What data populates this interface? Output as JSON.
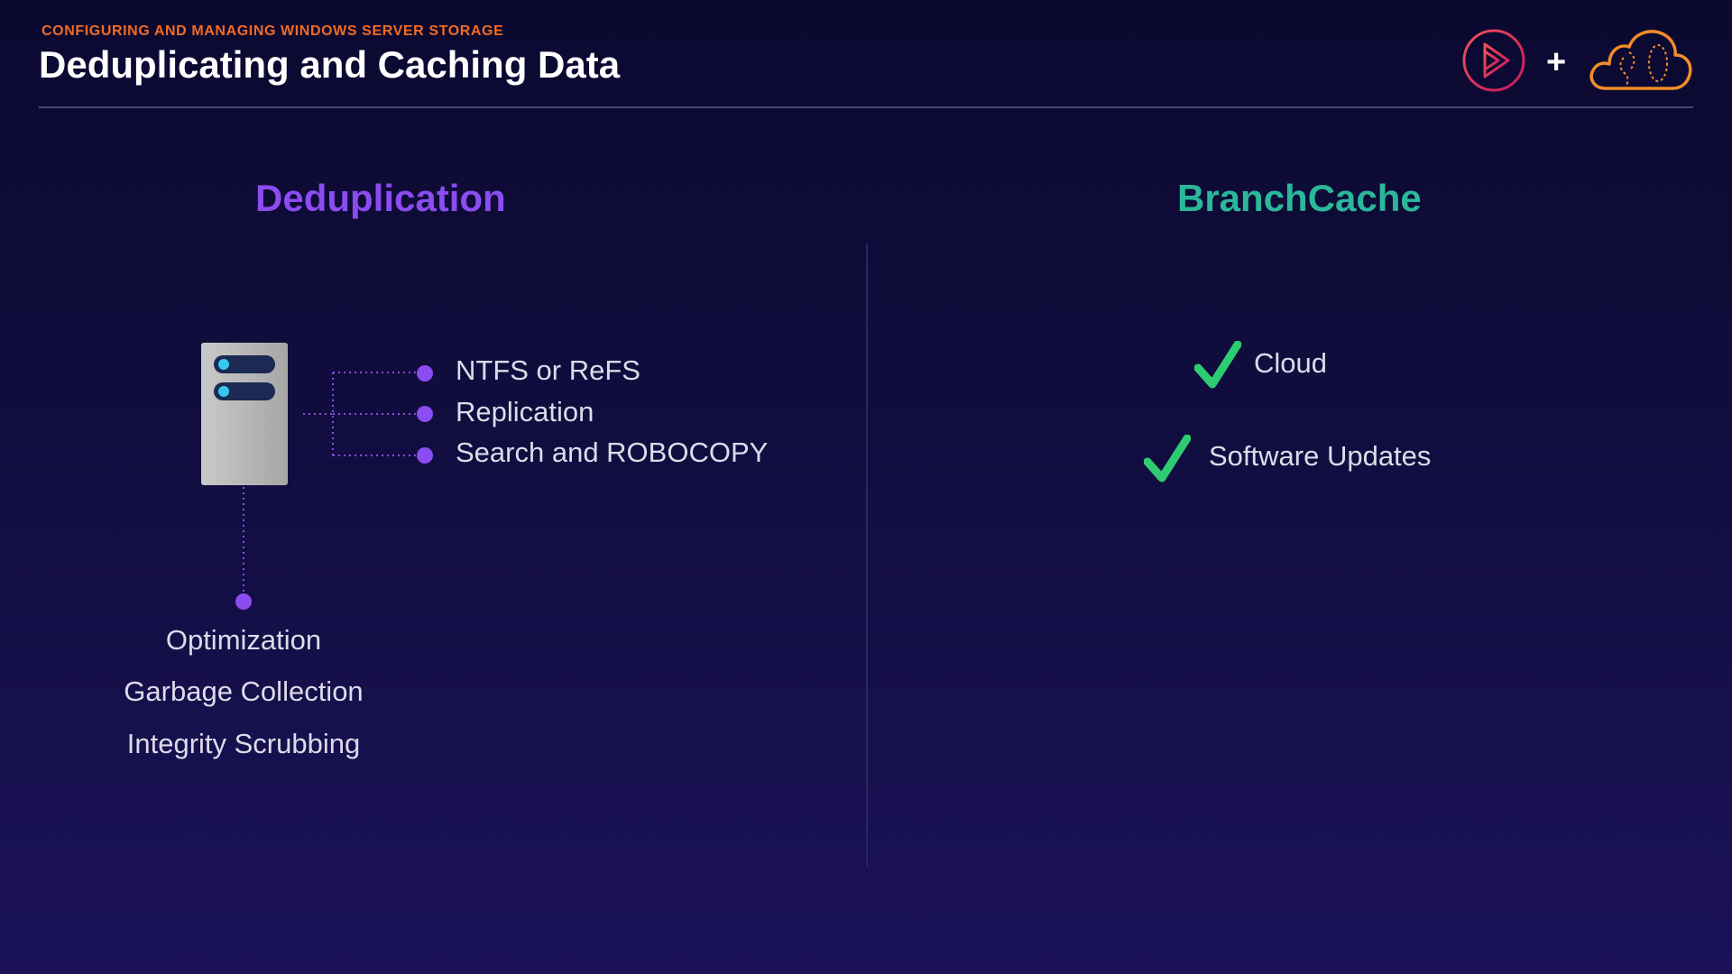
{
  "header": {
    "course_name": "CONFIGURING AND MANAGING WINDOWS SERVER STORAGE",
    "title": "Deduplicating and Caching Data",
    "plus": "+"
  },
  "icons": {
    "brand_logo": "play-logo-icon",
    "cloud_logo": "cloud-logo-icon",
    "server": "server-icon",
    "check": "check-icon"
  },
  "colors": {
    "background_top": "#0b0930",
    "background_bottom": "#1b1258",
    "course_name": "#f26b21",
    "dedup_heading": "#8b4cf0",
    "branchcache_heading": "#2bb89a",
    "bullet": "#8b4cf0",
    "check": "#2ecc71",
    "play_logo": "#e0325f",
    "cloud_logo": "#f28c28"
  },
  "dedup": {
    "heading": "Deduplication",
    "features": [
      "NTFS or ReFS",
      "Replication",
      "Search and ROBOCOPY"
    ],
    "tasks": [
      "Optimization",
      "Garbage Collection",
      "Integrity Scrubbing"
    ]
  },
  "branchcache": {
    "heading": "BranchCache",
    "items": [
      "Cloud",
      "Software Updates"
    ]
  }
}
